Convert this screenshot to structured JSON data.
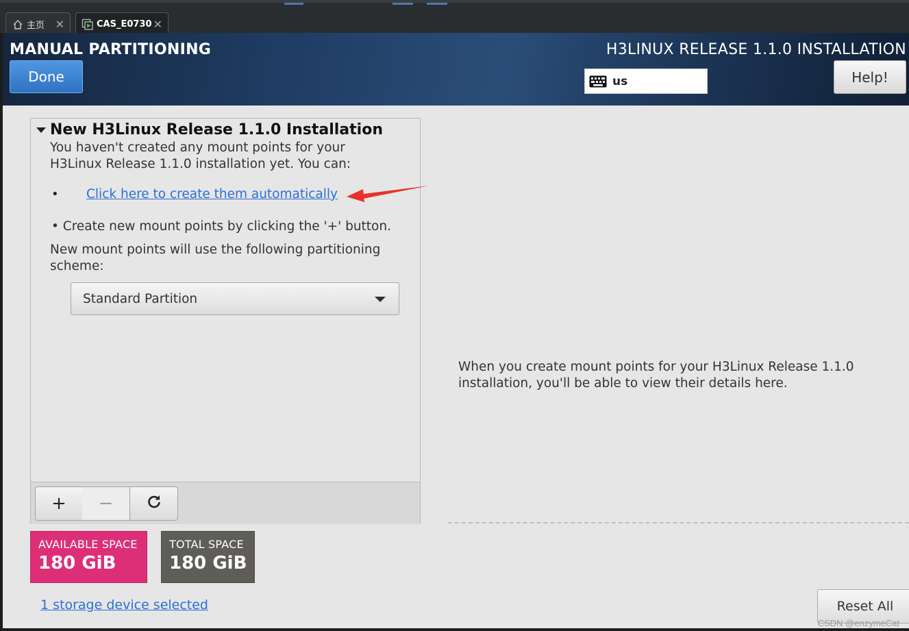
{
  "viewer": {
    "tabs": [
      {
        "label": "主页",
        "icon": "home-icon"
      },
      {
        "label": "CAS_E0730",
        "icon": "vm-console-icon"
      }
    ]
  },
  "header": {
    "title": "MANUAL PARTITIONING",
    "done_label": "Done",
    "release_title": "H3LINUX RELEASE 1.1.0 INSTALLATION",
    "keyboard_layout": "us",
    "help_label": "Help!"
  },
  "left_panel": {
    "section_title": "New H3Linux Release 1.1.0 Installation",
    "intro": "You haven't created any mount points for your\nH3Linux Release 1.1.0 installation yet.  You can:",
    "bullet_marker": "•",
    "auto_link": "Click here to create them automatically",
    "manual_hint": "•  Create new mount points by clicking the '+' button.",
    "scheme_text": "New mount points will use the following partitioning scheme:",
    "scheme_selected": "Standard Partition",
    "toolbar": {
      "add": "+",
      "remove": "−",
      "refresh": "⟳"
    }
  },
  "space": {
    "available_label": "AVAILABLE SPACE",
    "available_value": "180 GiB",
    "total_label": "TOTAL SPACE",
    "total_value": "180 GiB"
  },
  "storage_link": "1 storage device selected",
  "details_message": "When you create mount points for your H3Linux Release 1.1.0 installation, you'll be able to view their details here.",
  "reset_label": "Reset All",
  "watermark": "CSDN @enzymeCat",
  "colors": {
    "accent_blue": "#2f72c2",
    "link_blue": "#2a6fd6",
    "available_pink": "#dd2f77",
    "total_gray": "#5f5d58",
    "annotation_red": "#e8312a"
  }
}
